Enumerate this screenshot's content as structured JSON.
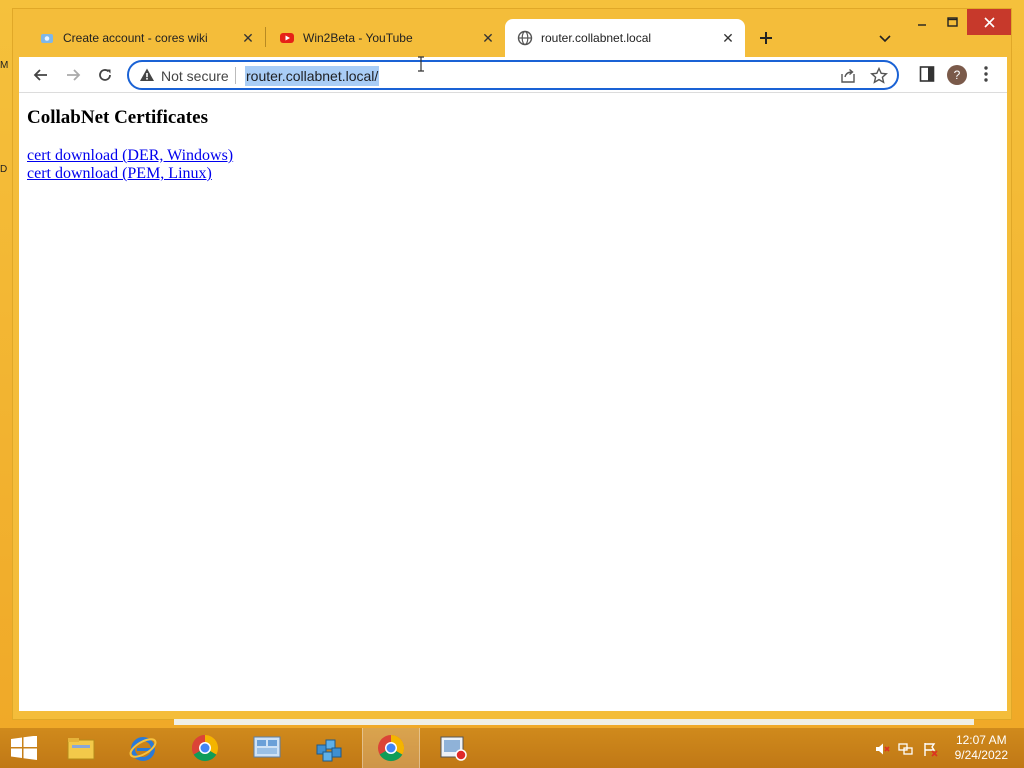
{
  "desktop": {
    "peek_letters": [
      "M",
      "D"
    ]
  },
  "window": {
    "controls": {
      "minimize": "–",
      "maximize": "□",
      "close": "✕"
    }
  },
  "tabs": [
    {
      "title": "Create account - cores wiki",
      "icon": "wiki-icon"
    },
    {
      "title": "Win2Beta - YouTube",
      "icon": "youtube-icon"
    },
    {
      "title": "router.collabnet.local",
      "icon": "globe-icon",
      "active": true
    }
  ],
  "toolbar": {
    "security_label": "Not secure",
    "url": "router.collabnet.local/",
    "profile_initial": "?"
  },
  "page": {
    "heading": "CollabNet Certificates",
    "links": [
      "cert download (DER, Windows)",
      "cert download (PEM, Linux)"
    ]
  },
  "taskbar": {
    "apps": [
      "windows-start-icon",
      "file-explorer-icon",
      "internet-explorer-icon",
      "chrome-icon",
      "control-panel-icon",
      "registry-icon",
      "chrome-active-icon",
      "recorder-icon"
    ],
    "time": "12:07 AM",
    "date": "9/24/2022"
  },
  "colors": {
    "accent": "#1a62d5",
    "desktop": "#f2b430",
    "link": "#0000ee"
  }
}
